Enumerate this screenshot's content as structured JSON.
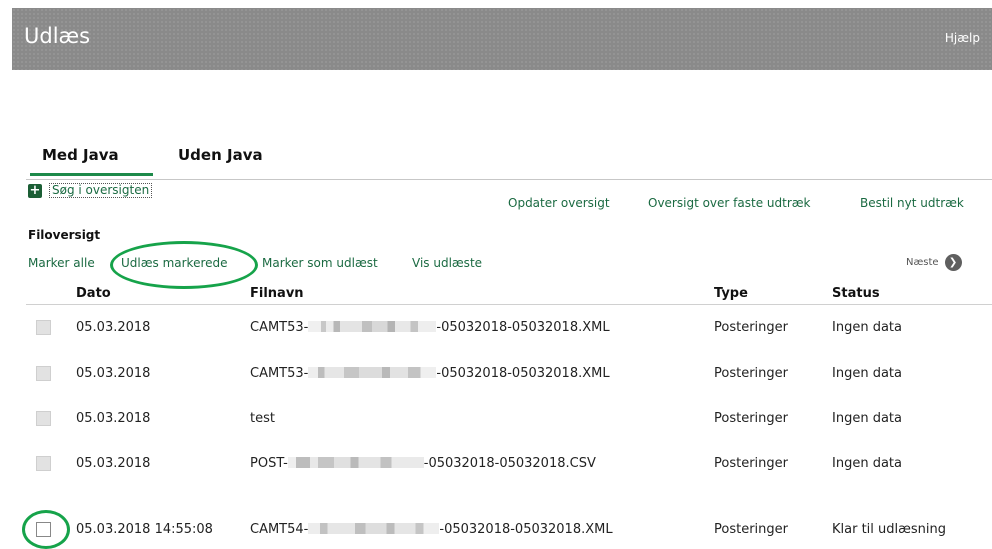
{
  "header": {
    "title": "Udlæs",
    "help": "Hjælp"
  },
  "tabs": [
    {
      "label": "Med Java",
      "active": true
    },
    {
      "label": "Uden Java",
      "active": false
    }
  ],
  "search_toggle": {
    "label": "Søg i oversigten",
    "icon": "plus-icon"
  },
  "top_links": {
    "update": "Opdater oversigt",
    "fixed": "Oversigt over faste udtræk",
    "order": "Bestil nyt udtræk"
  },
  "section_title": "Filoversigt",
  "actions": {
    "mark_all": "Marker alle",
    "read_marked": "Udlæs markerede",
    "mark_read": "Marker som udlæst",
    "show_read": "Vis udlæste"
  },
  "pager": {
    "next": "Næste",
    "icon": "chevron-right-icon"
  },
  "table": {
    "headers": {
      "date": "Dato",
      "file": "Filnavn",
      "type": "Type",
      "status": "Status"
    },
    "rows": [
      {
        "date": "05.03.2018",
        "file_prefix": "CAMT53-",
        "file_suffix": "-05032018-05032018.XML",
        "type": "Posteringer",
        "status": "Ingen data",
        "enabled": false
      },
      {
        "date": "05.03.2018",
        "file_prefix": "CAMT53-",
        "file_suffix": "-05032018-05032018.XML",
        "type": "Posteringer",
        "status": "Ingen data",
        "enabled": false
      },
      {
        "date": "05.03.2018",
        "file_prefix": "test",
        "file_suffix": "",
        "type": "Posteringer",
        "status": "Ingen data",
        "enabled": false
      },
      {
        "date": "05.03.2018",
        "file_prefix": "POST-",
        "file_suffix": "-05032018-05032018.CSV",
        "type": "Posteringer",
        "status": "Ingen data",
        "enabled": false
      },
      {
        "date": "05.03.2018 14:55:08",
        "file_prefix": "CAMT54-",
        "file_suffix": "-05032018-05032018.XML",
        "type": "Posteringer",
        "status": "Klar til udlæsning",
        "enabled": true
      }
    ]
  },
  "colors": {
    "accent": "#1b6a42",
    "highlight": "#16a34a",
    "header_bg": "#8a8a8a"
  }
}
